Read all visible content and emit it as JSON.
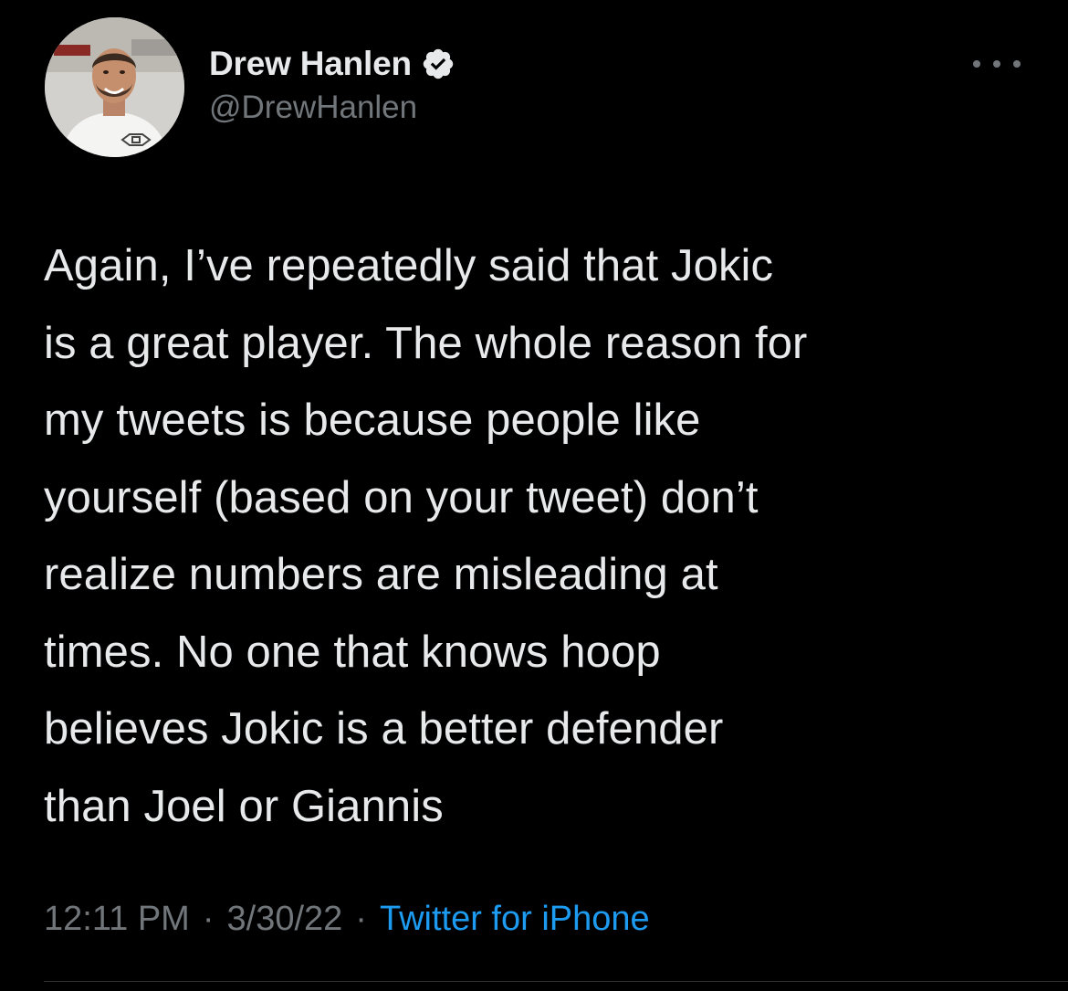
{
  "tweet": {
    "author": {
      "name": "Drew Hanlen",
      "handle": "@DrewHanlen",
      "verified": true
    },
    "text": "Again, I’ve repeatedly said that Jokic\nis a great player. The whole reason for\nmy tweets is because people like\nyourself (based on your tweet) don’t\nrealize numbers are misleading at\ntimes. No one that knows hoop\nbelieves Jokic is a better defender\nthan Joel or Giannis",
    "meta": {
      "time": "12:11 PM",
      "separator": "·",
      "date": "3/30/22",
      "source": "Twitter for iPhone"
    },
    "icons": {
      "verified": "verified-badge-icon",
      "more": "more-options-icon"
    },
    "colors": {
      "background": "#000000",
      "text": "#e7e9ea",
      "secondary": "#71767b",
      "accent": "#1d9bf0"
    }
  }
}
